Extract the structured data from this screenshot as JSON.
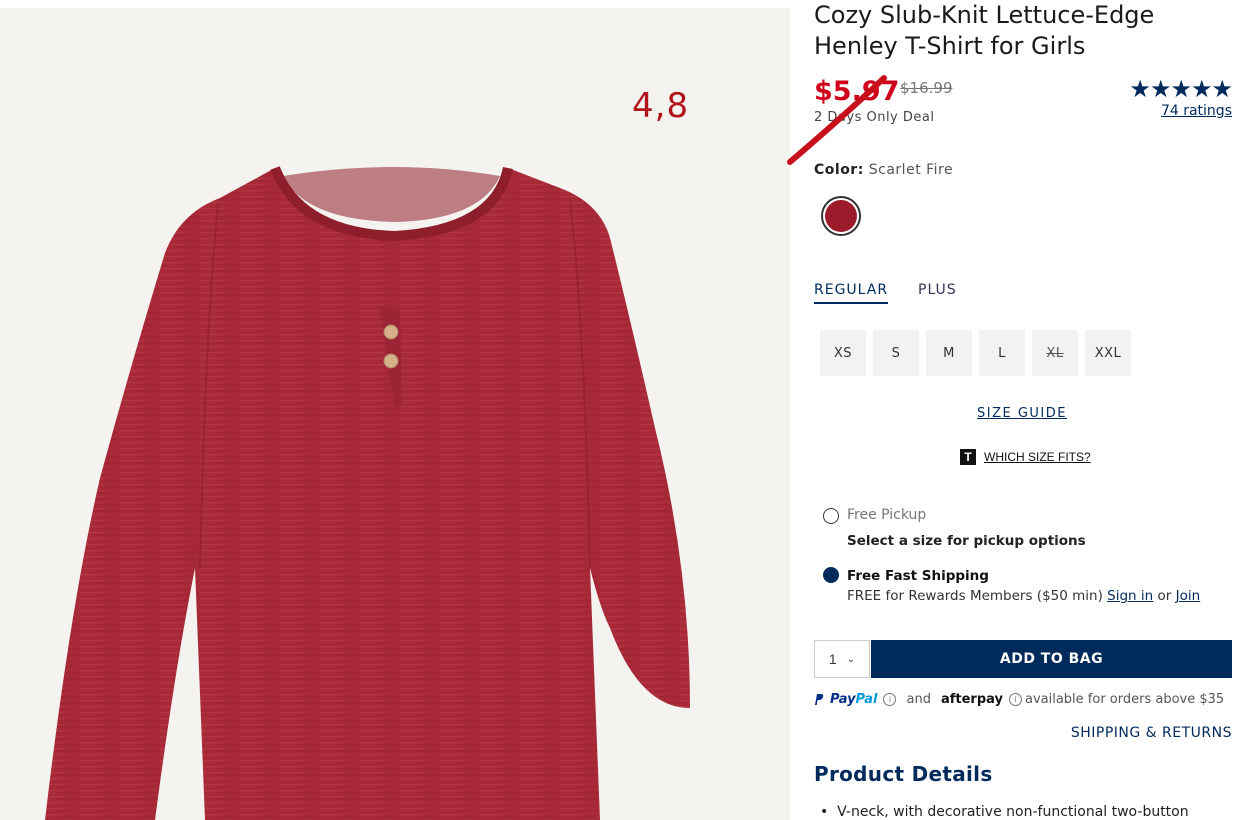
{
  "product": {
    "title": "Cozy Slub-Knit Lettuce-Edge Henley T-Shirt for Girls",
    "sale_price": "$5.97",
    "original_price": "$16.99",
    "deal_text": "2 Days Only Deal",
    "stars": "★★★★★",
    "rating_value": 5,
    "ratings_count": "74 ratings",
    "image_annotation": "4,8"
  },
  "color": {
    "label": "Color:",
    "name": "Scarlet Fire",
    "swatch_hex": "#9c1c2c"
  },
  "fit_tabs": [
    "REGULAR",
    "PLUS"
  ],
  "sizes": [
    {
      "label": "XS",
      "available": true
    },
    {
      "label": "S",
      "available": true
    },
    {
      "label": "M",
      "available": true
    },
    {
      "label": "L",
      "available": true
    },
    {
      "label": "XL",
      "available": false
    },
    {
      "label": "XXL",
      "available": true
    }
  ],
  "size_guide": "SIZE GUIDE",
  "which_size_fits": {
    "logo": "T",
    "text": "WHICH SIZE FITS?"
  },
  "fulfillment": {
    "pickup_label": "Free Pickup",
    "pickup_sub": "Select a size for pickup options",
    "shipping_label": "Free Fast Shipping",
    "shipping_sub": "FREE for Rewards Members ($50 min)",
    "sign_in": "Sign in",
    "or": "or",
    "join": "Join"
  },
  "cart": {
    "quantity": "1",
    "add_to_bag": "ADD TO BAG"
  },
  "payment": {
    "paypal_a": "Pay",
    "paypal_b": "Pal",
    "and": "and",
    "afterpay": "afterpay",
    "note": "available for orders above $35"
  },
  "shipping_returns": "SHIPPING & RETURNS",
  "details": {
    "heading": "Product Details",
    "bullets": [
      "V-neck, with decorative non-functional two-button"
    ]
  },
  "colors": {
    "brand_navy": "#002a5c",
    "sale_red": "#d0021b"
  }
}
